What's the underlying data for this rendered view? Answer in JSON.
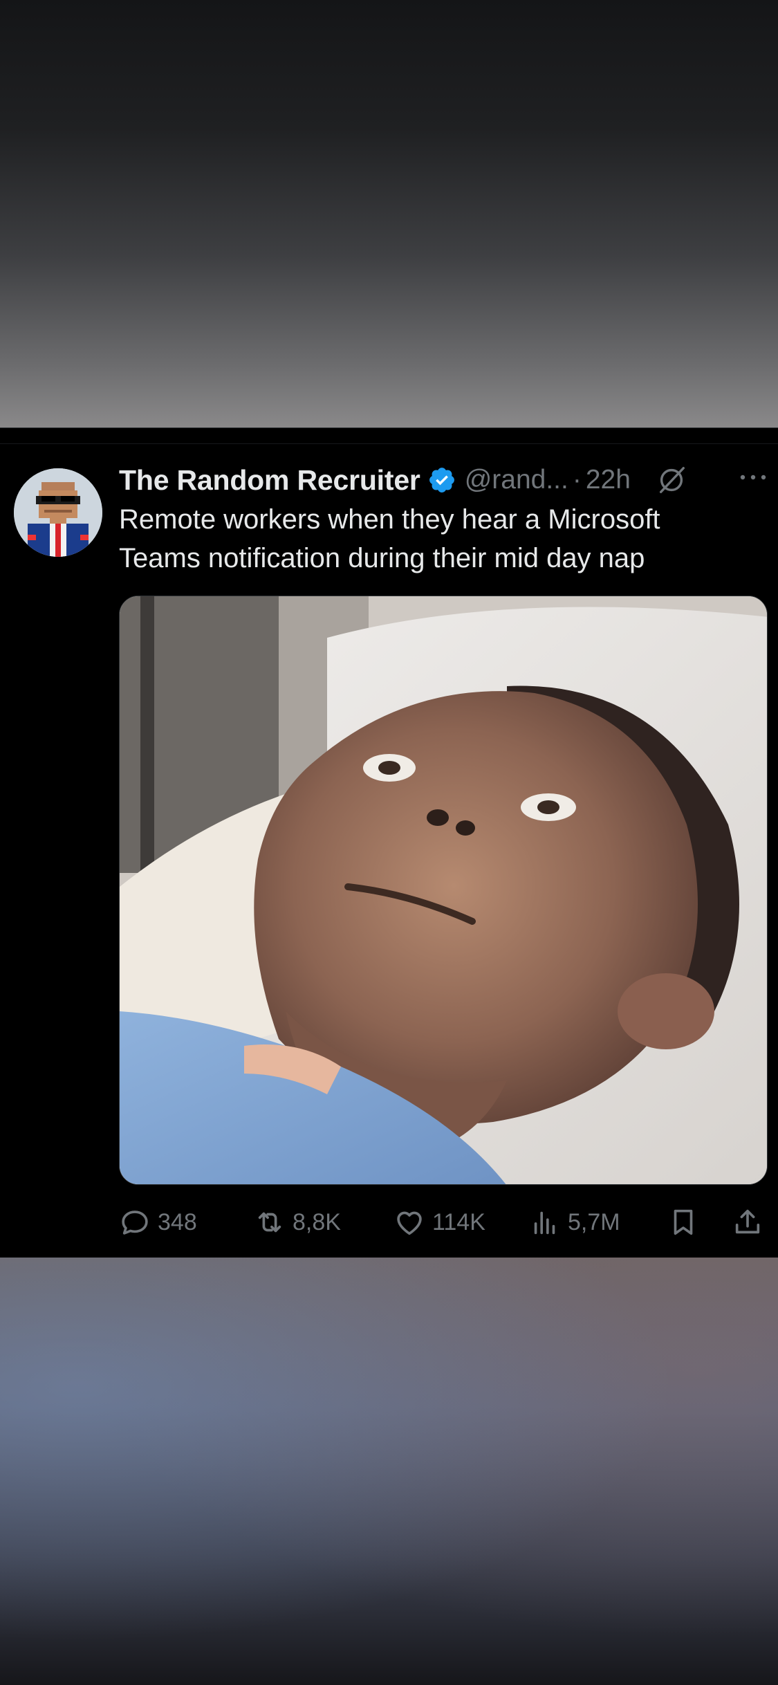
{
  "tweet": {
    "display_name": "The Random Recruiter",
    "handle": "@rand...",
    "separator": "·",
    "time": "22h",
    "text_line1": "Remote workers when they hear a Microsoft",
    "text_line2": "Teams notification during their mid day nap"
  },
  "actions": {
    "replies": "348",
    "reposts": "8,8K",
    "likes": "114K",
    "views": "5,7M"
  },
  "icons": [
    "verified-badge-icon",
    "grok-icon",
    "more-icon",
    "reply-icon",
    "repost-icon",
    "like-icon",
    "views-icon",
    "bookmark-icon",
    "share-icon"
  ],
  "colors": {
    "background": "#000000",
    "text": "#e7e9ea",
    "muted": "#71767b",
    "verified": "#1d9bf0"
  }
}
